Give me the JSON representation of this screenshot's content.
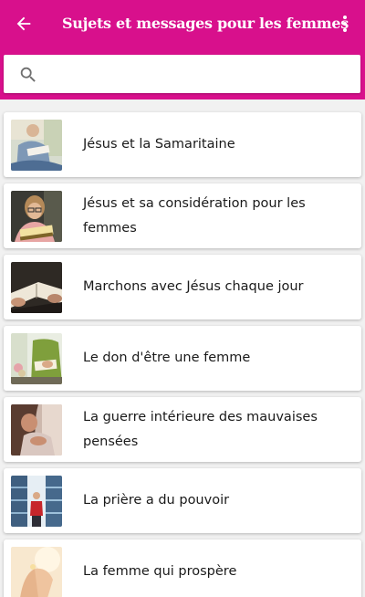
{
  "header": {
    "title": "Sujets et messages pour les femmes",
    "back_icon": "arrow-left-icon",
    "more_icon": "more-vertical-icon",
    "background_color": "#d8108c"
  },
  "search": {
    "icon": "search-icon",
    "placeholder": "",
    "value": ""
  },
  "items": [
    {
      "label": "Jésus et la Samaritaine",
      "thumbnail": "woman-reading-bible-sofa"
    },
    {
      "label": "Jésus et sa considération pour les femmes",
      "thumbnail": "woman-glasses-reading"
    },
    {
      "label": "Marchons avec Jésus chaque jour",
      "thumbnail": "open-bible-hands"
    },
    {
      "label": "Le don d'être une femme",
      "thumbnail": "woman-green-sweater-bible"
    },
    {
      "label": "La guerre intérieure des mauvaises pensées",
      "thumbnail": "woman-head-down-thinking"
    },
    {
      "label": "La prière a du pouvoir",
      "thumbnail": "woman-library-aisle"
    },
    {
      "label": "La femme qui prospère",
      "thumbnail": "hands-light-flower"
    }
  ]
}
